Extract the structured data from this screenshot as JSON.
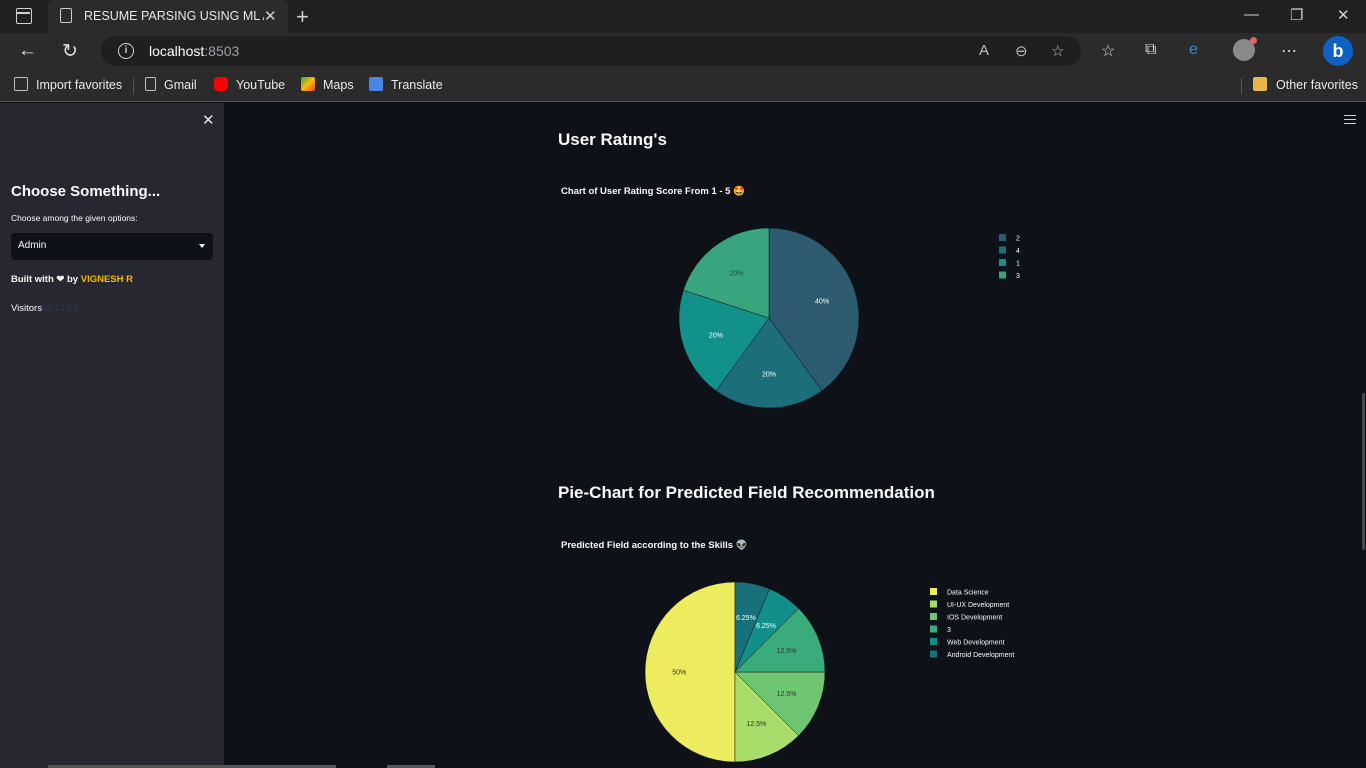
{
  "browser": {
    "tab_title": "RESUME PARSING USING ML AN",
    "url_host": "localhost",
    "url_port": ":8503",
    "favorites": [
      {
        "label": "Import favorites",
        "icon": "import-icon",
        "color": "#bdbdbd"
      },
      {
        "label": "Gmail",
        "icon": "page-icon",
        "color": "#bdbdbd"
      },
      {
        "label": "YouTube",
        "icon": "youtube-icon",
        "color": "#ff0000"
      },
      {
        "label": "Maps",
        "icon": "maps-icon",
        "color": "#34a853"
      },
      {
        "label": "Translate",
        "icon": "translate-icon",
        "color": "#4a86e8"
      }
    ],
    "other_favorites": "Other favorites"
  },
  "sidebar": {
    "heading": "Choose Something...",
    "select_label": "Choose among the given options:",
    "select_value": "Admin",
    "built_prefix": "Built with",
    "built_heart": "❤",
    "built_by": "by",
    "built_author": "VIGNESH R",
    "visitors_label": "Visitors",
    "visitors_count": "001128"
  },
  "main": {
    "section1_title": "User Ratıng's",
    "section2_title": "Pie-Chart for Predicted Field Recommendation"
  },
  "chart_data": [
    {
      "type": "pie",
      "title": "Chart of User Rating Score From 1 - 5 🤩",
      "labels": [
        "2",
        "4",
        "1",
        "3"
      ],
      "values": [
        40,
        20,
        20,
        20
      ],
      "value_labels": [
        "40%",
        "20%",
        "20%",
        "20%"
      ],
      "colors": [
        "#2c5b70",
        "#1c6e7b",
        "#119189",
        "#38a57e"
      ],
      "label_colors": [
        "#ffffff",
        "#ffffff",
        "#ffffff",
        "#1b4d3e"
      ],
      "legend_position": "right"
    },
    {
      "type": "pie",
      "title": "Predicted Field according to the Skills 👽",
      "labels": [
        "Data Science",
        "UI-UX Development",
        "IOS Development",
        "3",
        "Web Development",
        "Android Development"
      ],
      "values": [
        50,
        12.5,
        12.5,
        12.5,
        6.25,
        6.25
      ],
      "value_labels": [
        "50%",
        "12.5%",
        "12.5%",
        "12.5%",
        "6.25%",
        "6.25%"
      ],
      "colors": [
        "#ecec5e",
        "#a8dc6b",
        "#6ec673",
        "#3aab7b",
        "#118f88",
        "#17707a"
      ],
      "label_colors": [
        "#333333",
        "#333333",
        "#333333",
        "#333333",
        "#ffffff",
        "#ffffff"
      ],
      "legend_position": "right"
    }
  ]
}
